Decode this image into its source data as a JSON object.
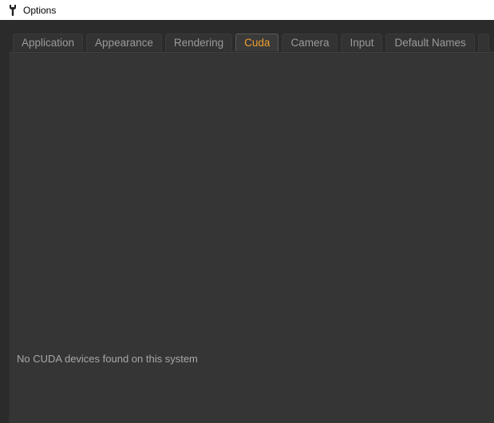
{
  "window": {
    "title": "Options",
    "icon": "wrench-icon"
  },
  "tabs": [
    {
      "label": "Application",
      "active": false
    },
    {
      "label": "Appearance",
      "active": false
    },
    {
      "label": "Rendering",
      "active": false
    },
    {
      "label": "Cuda",
      "active": true
    },
    {
      "label": "Camera",
      "active": false
    },
    {
      "label": "Input",
      "active": false
    },
    {
      "label": "Default Names",
      "active": false
    },
    {
      "label": "",
      "active": false
    }
  ],
  "cuda_panel": {
    "message": "No CUDA devices found on this system"
  },
  "colors": {
    "background": "#2b2b2b",
    "panel": "#353535",
    "tab_text": "#9a9a9a",
    "active_tab_text": "#f0a030",
    "message_text": "#a8a8a8"
  }
}
